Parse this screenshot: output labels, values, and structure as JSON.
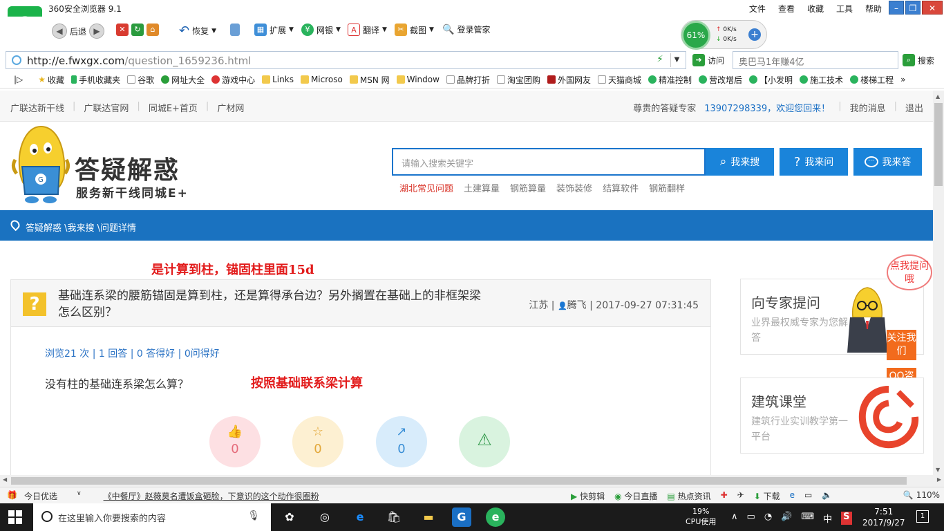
{
  "browser": {
    "title": "360安全浏览器 9.1",
    "menu": [
      "文件",
      "查看",
      "收藏",
      "工具",
      "帮助"
    ],
    "toolbar": {
      "back": "后退",
      "restore": "恢复",
      "extend": "扩展",
      "bank": "网银",
      "translate": "翻译",
      "screenshot": "截图",
      "login": "登录管家"
    },
    "net": {
      "percent": "61%",
      "up": "0K/s",
      "down": "0K/s"
    },
    "url_host": "http://e.fwxgx.com",
    "url_path": "/question_1659236.html",
    "go": "访问",
    "search_value": "奥巴马1年赚4亿",
    "search": "搜索",
    "bookmarks": [
      "收藏",
      "手机收藏夹",
      "谷歌",
      "网址大全",
      "游戏中心",
      "Links",
      "Microso",
      "MSN 网",
      "Window",
      "品牌打折",
      "淘宝团购",
      "外国网友",
      "天猫商城",
      "精准控制",
      "营改增后",
      "【小发明",
      "施工技术",
      "楼梯工程"
    ]
  },
  "site": {
    "toplinks": [
      "广联达新干线",
      "广联达官网",
      "同城E+首页",
      "广材网"
    ],
    "greeting_label": "尊贵的答疑专家",
    "greeting_user": "13907298339，欢迎您回来！",
    "my_messages": "我的消息",
    "logout": "退出",
    "brand": "答疑解惑",
    "brand_sub": "服务新干线同城E+",
    "search_placeholder": "请输入搜索关键字",
    "btn_search": "我来搜",
    "btn_ask": "我来问",
    "btn_answer": "我来答",
    "hotlinks": [
      "湖北常见问题",
      "土建算量",
      "钢筋算量",
      "装饰装修",
      "结算软件",
      "钢筋翻样"
    ],
    "breadcrumb": "答疑解惑 \\我来搜 \\问题详情"
  },
  "annotations": {
    "top": "是计算到柱，锚固柱里面15d",
    "inline": "按照基础联系梁计算"
  },
  "question": {
    "title": "基础连系梁的腰筋锚固是算到柱，还是算得承台边？另外搁置在基础上的非框架梁怎么区别？",
    "region": "江苏",
    "user": "腾飞",
    "datetime": "2017-09-27 07:31:45",
    "stats": "浏览21 次 | 1 回答 | 0 答得好 | 0问得好",
    "body": "没有柱的基础连系梁怎么算？",
    "actions": {
      "like": "0",
      "favorite": "0",
      "share": "0"
    }
  },
  "sidebar": {
    "expert_title": "向专家提问",
    "expert_sub": "业界最权威专家为您解答",
    "bubble": "点我提问哦",
    "follow": "关注我们",
    "qq": "QQ咨询",
    "class_title": "建筑课堂",
    "class_sub": "建筑行业实训教学第一平台"
  },
  "statusbar": {
    "today": "今日优选",
    "headline": "《中餐厅》赵薇莫名遭饭盒砸脸，下意识的这个动作很圈粉",
    "tools": [
      "快剪辑",
      "今日直播",
      "热点资讯"
    ],
    "download": "下载",
    "zoom": "110%"
  },
  "taskbar": {
    "search_placeholder": "在这里输入你要搜索的内容",
    "cpu_pct": "19%",
    "cpu_label": "CPU使用",
    "ime": "中",
    "time": "7:51",
    "date": "2017/9/27",
    "notif_count": "1"
  },
  "colors": {
    "accent": "#1a72c0",
    "annotation": "#e21b1b",
    "orange": "#f26b1d"
  }
}
